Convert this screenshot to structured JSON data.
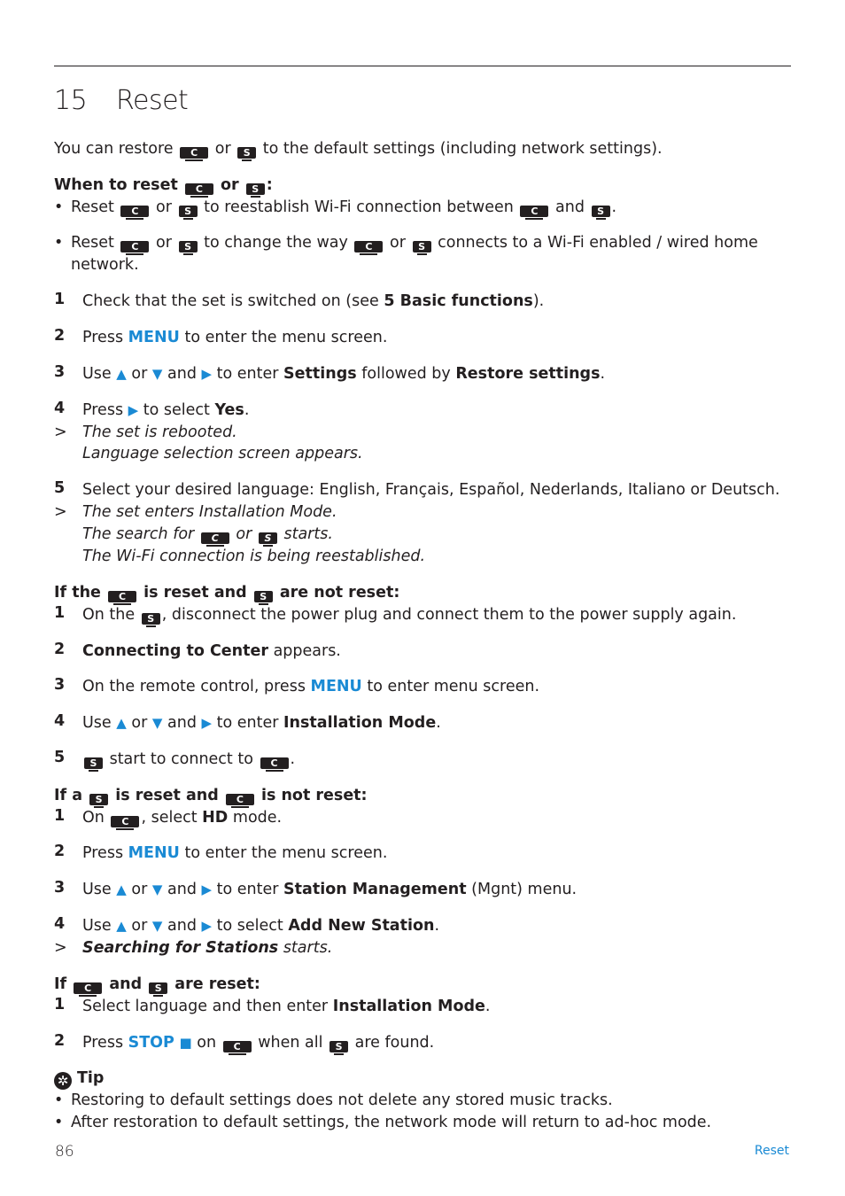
{
  "chapter": {
    "number": "15",
    "title": "Reset"
  },
  "intro": {
    "p1": "You can restore",
    "p2": "or",
    "p3": "to the default settings (including network settings)."
  },
  "devices": {
    "center": "C",
    "station": "S"
  },
  "when": {
    "heading_a": "When to reset",
    "heading_b": "or",
    "heading_c": ":",
    "b1": {
      "a": "Reset",
      "b": "or",
      "c": "to reestablish Wi-Fi connection between",
      "d": "and",
      "e": "."
    },
    "b2": {
      "a": "Reset",
      "b": "or",
      "c": "to change the way",
      "d": "or",
      "e": "connects to a Wi-Fi enabled / wired home",
      "f": "network."
    }
  },
  "steps_main": {
    "s1": {
      "n": "1",
      "a": "Check that the set is switched on (see",
      "b": "5 Basic functions",
      "c": ")."
    },
    "s2": {
      "n": "2",
      "a": "Press",
      "b": "MENU",
      "c": "to enter the menu screen."
    },
    "s3": {
      "n": "3",
      "a": "Use",
      "or": "or",
      "and": "and",
      "b": "to enter",
      "c": "Settings",
      "d": "followed by",
      "e": "Restore settings",
      "f": "."
    },
    "s4": {
      "n": "4",
      "a": "Press",
      "b": "to select",
      "c": "Yes",
      "d": ".",
      "r_marker": ">",
      "r1": "The set is rebooted.",
      "r2": "Language selection screen appears."
    },
    "s5": {
      "n": "5",
      "a": "Select your desired language: English, Français, Español, Nederlands, Italiano or Deutsch.",
      "r_marker": ">",
      "r1": "The set enters Installation Mode.",
      "r2a": "The search for",
      "r2b": "or",
      "r2c": "starts.",
      "r3": "The Wi-Fi connection is being reestablished."
    }
  },
  "center_reset": {
    "heading_a": "If the",
    "heading_b": "is reset and",
    "heading_c": "are not reset:",
    "s1": {
      "n": "1",
      "a": "On the",
      "b": ", disconnect the power plug and connect them to the power supply again."
    },
    "s2": {
      "n": "2",
      "a": "Connecting to Center",
      "b": "appears."
    },
    "s3": {
      "n": "3",
      "a": "On the remote control, press",
      "b": "MENU",
      "c": "to enter menu screen."
    },
    "s4": {
      "n": "4",
      "a": "Use",
      "or": "or",
      "and": "and",
      "b": "to enter",
      "c": "Installation Mode",
      "d": "."
    },
    "s5": {
      "n": "5",
      "a": "start to connect to",
      "b": "."
    }
  },
  "station_reset": {
    "heading_a": "If a",
    "heading_b": "is reset and",
    "heading_c": "is not reset:",
    "s1": {
      "n": "1",
      "a": "On",
      "b": ", select",
      "c": "HD",
      "d": "mode."
    },
    "s2": {
      "n": "2",
      "a": "Press",
      "b": "MENU",
      "c": "to enter the menu screen."
    },
    "s3": {
      "n": "3",
      "a": "Use",
      "or": "or",
      "and": "and",
      "b": "to enter",
      "c": "Station Management",
      "d": "(Mgnt) menu."
    },
    "s4": {
      "n": "4",
      "a": "Use",
      "or": "or",
      "and": "and",
      "b": "to select",
      "c": "Add New Station",
      "d": ".",
      "r_marker": ">",
      "r1": "Searching for Stations",
      "r2": "starts."
    }
  },
  "both_reset": {
    "heading_a": "If",
    "heading_b": "and",
    "heading_c": "are reset:",
    "s1": {
      "n": "1",
      "a": "Select language and then enter",
      "b": "Installation Mode",
      "c": "."
    },
    "s2": {
      "n": "2",
      "a": "Press",
      "b": "STOP",
      "c": "on",
      "d": "when all",
      "e": "are found."
    }
  },
  "tip": {
    "heading": "Tip",
    "items": [
      "Restoring to default settings does not delete any stored music tracks.",
      "After restoration to default settings, the network mode will return to ad-hoc mode."
    ]
  },
  "icons": {
    "up": "▲",
    "down": "▼",
    "right": "▶",
    "stop": "■",
    "tip": "✲",
    "bullet": "•"
  },
  "footer": {
    "page": "86",
    "section": "Reset"
  },
  "colors": {
    "accent": "#1a8ad4",
    "text": "#231f20"
  }
}
